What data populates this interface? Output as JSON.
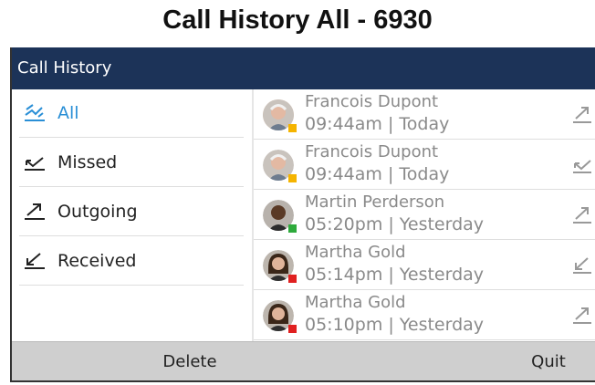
{
  "caption": "Call History All - 6930",
  "header": {
    "title": "Call History"
  },
  "filters": [
    {
      "label": "All",
      "icon": "all-calls-icon",
      "active": true
    },
    {
      "label": "Missed",
      "icon": "missed-call-icon",
      "active": false
    },
    {
      "label": "Outgoing",
      "icon": "outgoing-call-icon",
      "active": false
    },
    {
      "label": "Received",
      "icon": "received-call-icon",
      "active": false
    }
  ],
  "calls": [
    {
      "name": "Francois Dupont",
      "time": "09:44am | Today",
      "type": "outgoing",
      "presence": "#f5b400"
    },
    {
      "name": "Francois Dupont",
      "time": "09:44am | Today",
      "type": "missed",
      "presence": "#f5b400"
    },
    {
      "name": "Martin Perderson",
      "time": "05:20pm | Yesterday",
      "type": "outgoing",
      "presence": "#2eaa3c"
    },
    {
      "name": "Martha Gold",
      "time": "05:14pm | Yesterday",
      "type": "received",
      "presence": "#e02020"
    },
    {
      "name": "Martha Gold",
      "time": "05:10pm | Yesterday",
      "type": "outgoing",
      "presence": "#e02020"
    }
  ],
  "softkeys": {
    "delete": "Delete",
    "quit": "Quit"
  },
  "colors": {
    "titlebar": "#1c3358",
    "accent": "#2a8fd6",
    "softkey_bar": "#cfcfcf"
  }
}
